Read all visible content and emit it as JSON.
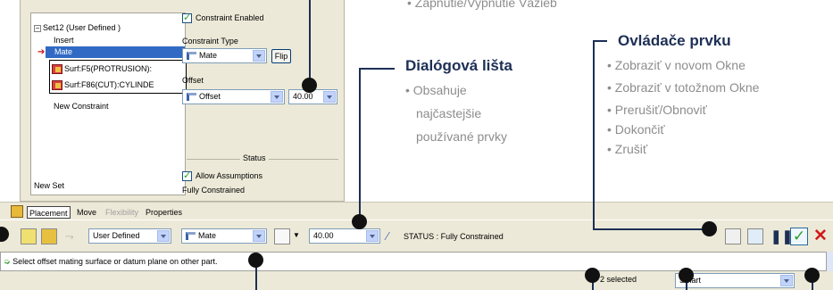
{
  "dialog": {
    "tree": {
      "set_label": "Set12 (User Defined )",
      "insert": "Insert",
      "mate": "Mate",
      "refs": [
        "Surf:F5(PROTRUSION):",
        "Surf:F86(CUT):CYLINDE"
      ],
      "new_constraint": "New Constraint",
      "new_set": "New Set"
    },
    "constraint_enabled": "Constraint Enabled",
    "constraint_type_label": "Constraint Type",
    "constraint_type_value": "Mate",
    "flip_label": "Flip",
    "offset_label": "Offset",
    "offset_type_value": "Offset",
    "offset_value": "40.00",
    "status_label": "Status",
    "allow_assumptions": "Allow Assumptions",
    "status_text": "Fully Constrained"
  },
  "tabs": [
    "Placement",
    "Move",
    "Flexibility",
    "Properties"
  ],
  "toolbar": {
    "set_type": "User Defined",
    "constraint": "Mate",
    "offset": "40.00",
    "status": "STATUS : Fully Constrained"
  },
  "message": "Select offset mating surface or datum plane on other part.",
  "statusbar": {
    "selected": "2 selected",
    "filter": "Smart"
  },
  "annotations": {
    "top_item": "• Zapnutie/Vypnutie Väzieb",
    "dialog_bar": {
      "title": "Dialógová lišta",
      "items": [
        "• Obsahuje",
        "najčastejšie",
        "používané prvky"
      ]
    },
    "controls": {
      "title": "Ovládače prvku",
      "items": [
        "• Zobraziť v novom Okne",
        "• Zobraziť v totožnom Okne",
        "• Prerušiť/Obnoviť",
        "• Dokončiť",
        "• Zrušiť"
      ]
    }
  },
  "colors": {
    "accent": "#1d2f55",
    "selection": "#316ac5",
    "panel": "#ece9d8",
    "ok_green": "#2e9a2e",
    "cancel_red": "#d01a1a"
  }
}
